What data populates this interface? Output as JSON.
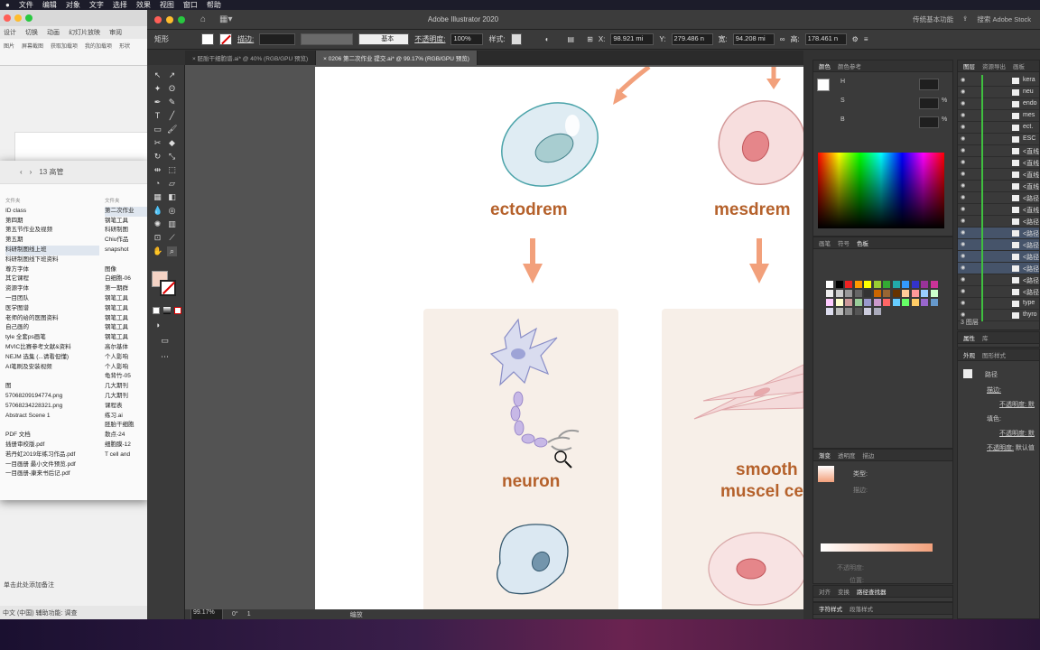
{
  "menubar": {
    "items": [
      "文件",
      "编辑",
      "对象",
      "文字",
      "选择",
      "效果",
      "视图",
      "窗口",
      "帮助"
    ]
  },
  "ppt": {
    "tabs": [
      "设计",
      "切换",
      "动画",
      "幻灯片放映",
      "审阅"
    ],
    "ribbon": [
      "图片",
      "屏幕截图",
      "获取加载项",
      "我的加载项",
      "形状"
    ],
    "note": "单击此处添加备注",
    "status": "中文 (中国)   辅助功能: 调查"
  },
  "finder": {
    "title": "13 高管",
    "col1_header": "文件夹",
    "col2_header": "文件夹",
    "col1": [
      "ID class",
      "第四期",
      "第五节作业及视频",
      "第五期",
      "科研制图线上班",
      "科研制图线下班资料",
      "尊方字体",
      "其它课程",
      "资源字体",
      "一目团队",
      "医学图谱",
      "老师的给的医图资料",
      "自己画的",
      "tyle 全套ps画笔",
      "MVIC比赛参考文献&资料",
      "NEJM 选集 (...请看但懂)",
      "AI笔刷及安装视频",
      "",
      "图",
      "57068209194774.png",
      "57068234228321.png",
      "Abstract Scene 1",
      "",
      "PDF 文档",
      "插册审校版.pdf",
      "若丹虹2019年练习作品.pdf",
      "一目画册 最小文件预览.pdf",
      "一目画册-康来书后记.pdf"
    ],
    "col2": [
      "第二次作业",
      "钢笔工具",
      "科研制图",
      "Chiu作品",
      "snapshot",
      "",
      "图像",
      "白细胞-06",
      "第一期群",
      "钢笔工具",
      "钢笔工具",
      "钢笔工具",
      "钢笔工具",
      "钢笔工具",
      "高尔基体",
      "个人影响",
      "个人影响",
      "龟背竹-05",
      "几大期刊",
      "几大期刊",
      "课程表",
      "练习.ai",
      "胚胎干细胞",
      "散点-24",
      "细胞膜-12",
      "T cell and"
    ]
  },
  "ai": {
    "title": "Adobe Illustrator 2020",
    "workspace": "传统基本功能",
    "search": "搜索 Adobe Stock",
    "ctrl": {
      "shape": "矩形",
      "stroke_label": "描边:",
      "style_label": "基本",
      "opacity_label": "不透明度:",
      "opacity": "100%",
      "style2": "样式:",
      "x_label": "X:",
      "x": "98.921 mi",
      "y_label": "Y:",
      "y": "279.486 n",
      "w_label": "宽:",
      "w": "94.208 mi",
      "h_label": "高:",
      "h": "178.461 n"
    },
    "tabs": [
      "胚胎干细胞谱.ai* @ 40% (RGB/GPU 预览)",
      "0206 第二次作业 提交.ai* @ 99.17% (RGB/GPU 预览)"
    ],
    "status": {
      "zoom": "99.17%",
      "rotation": "0°",
      "page": "1",
      "mode": "编放"
    },
    "canvas": {
      "labels": {
        "ectodrem": "ectodrem",
        "mesdrem": "mesdrem",
        "neuron": "neuron",
        "smooth1": "smooth",
        "smooth2": "muscel ce"
      }
    },
    "color_panel": {
      "tabs": [
        "颜色",
        "颜色参考"
      ],
      "h": "H",
      "s": "S",
      "b": "B",
      "pct": "%"
    },
    "swatch_panel": {
      "tabs": [
        "画笔",
        "符号",
        "色板"
      ]
    },
    "gradient_panel": {
      "tabs": [
        "渐变",
        "透明度",
        "描边"
      ],
      "type_label": "类型:",
      "stroke_label": "描边:",
      "opacity_label": "不透明度:",
      "position_label": "位置:"
    },
    "align_panel": {
      "tabs": [
        "对齐",
        "变换",
        "路径查找器"
      ]
    },
    "char_panel": {
      "tabs": [
        "字符样式",
        "段落样式"
      ]
    },
    "layers_panel": {
      "tabs": [
        "图层",
        "资源导出",
        "画板"
      ],
      "rows": [
        "kera",
        "neu",
        "endo",
        "mes",
        "ect.",
        "ESC",
        "<直线",
        "<直线",
        "<直线",
        "<直线",
        "<路径",
        "<直线",
        "<路径",
        "<路径",
        "<路径",
        "<路径",
        "<路径",
        "<路径",
        "<路径",
        "type",
        "thyro"
      ],
      "count": "3 图层"
    },
    "props_panel": {
      "tabs": [
        "属性",
        "库"
      ]
    },
    "appearance_panel": {
      "tabs": [
        "外观",
        "图形样式"
      ],
      "path": "路径",
      "stroke": "描边:",
      "opacity1": "不透明度:",
      "opacity1_val": "默",
      "fill": "填色:",
      "opacity2": "不透明度:",
      "opacity2_val": "默",
      "opacity3": "不透明度:",
      "opacity3_val": "默认值"
    }
  },
  "colors": {
    "accent_label": "#b5612b",
    "arrow": "#f2a07b",
    "bg": "#323232"
  }
}
